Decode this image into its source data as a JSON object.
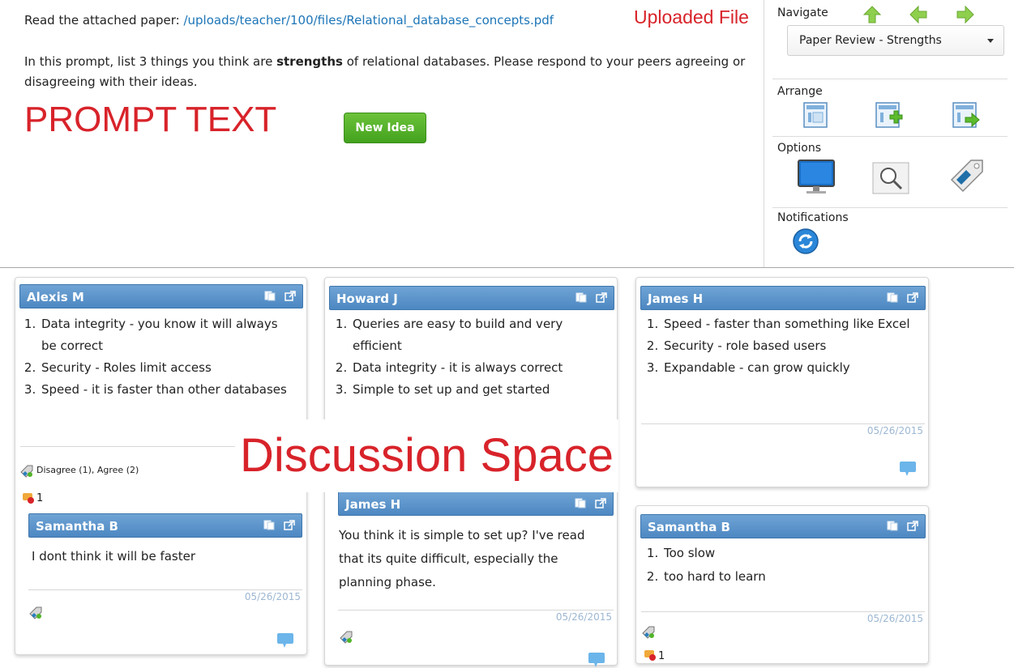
{
  "prompt": {
    "read_prefix": "Read the attached paper:",
    "file_link": "/uploads/teacher/100/files/Relational_database_concepts.pdf",
    "uploaded_tag": "Uploaded File",
    "text_before": "In this prompt, list 3 things you think are ",
    "text_bold": "strengths",
    "text_after": " of relational databases.  Please respond to your peers agreeing or disagreeing with their ideas.",
    "prompt_tag": "PROMPT TEXT",
    "new_idea_label": "New Idea"
  },
  "panel": {
    "navigate_label": "Navigate",
    "nav_selected": "Paper Review - Strengths",
    "arrange_label": "Arrange",
    "options_label": "Options",
    "notifications_label": "Notifications"
  },
  "discussion_tag": "Discussion Space",
  "cards": {
    "alexis": {
      "author": "Alexis M",
      "items": [
        "Data integrity - you know it will always be correct",
        "Security - Roles limit access",
        "Speed - it is faster than other databases"
      ],
      "votes": "Disagree (1), Agree (2)",
      "reply_count": "1"
    },
    "samantha_reply": {
      "author": "Samantha B",
      "text": "I dont think it will be faster",
      "date": "05/26/2015"
    },
    "howard": {
      "author": "Howard J",
      "items": [
        "Queries are easy to build and very efficient",
        "Data integrity - it is always correct",
        "Simple to set up and get started"
      ]
    },
    "james_reply": {
      "author": "James H",
      "text": "You think it is simple to set up?  I've read that its quite difficult, especially the planning phase.",
      "date": "05/26/2015"
    },
    "james": {
      "author": "James H",
      "items": [
        "Speed - faster than something like Excel",
        "Security - role based users",
        "Expandable - can grow quickly"
      ],
      "date": "05/26/2015"
    },
    "samantha": {
      "author": "Samantha B",
      "items": [
        "Too slow",
        "too hard to learn"
      ],
      "date": "05/26/2015",
      "reply_count": "1"
    }
  }
}
